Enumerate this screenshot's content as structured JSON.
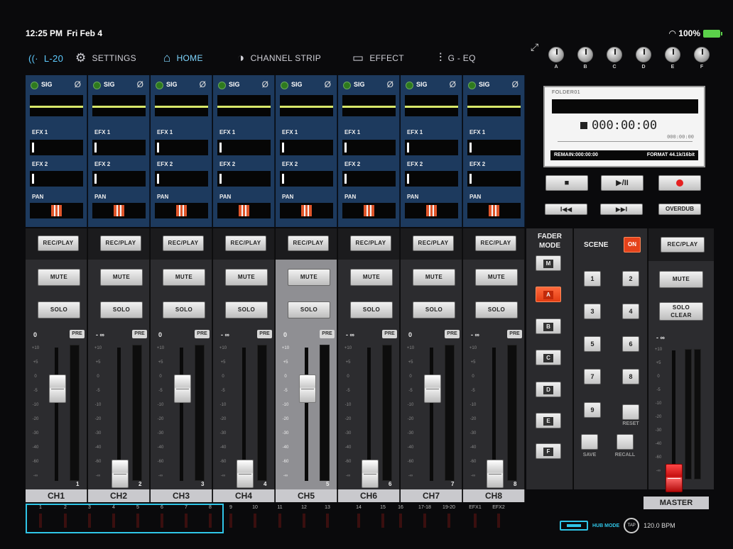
{
  "status": {
    "time": "12:25 PM",
    "date": "Fri Feb 4",
    "battery": "100%"
  },
  "nav": {
    "logo": "L-20",
    "items": [
      {
        "label": "SETTINGS",
        "icon": "gear-icon"
      },
      {
        "label": "HOME",
        "icon": "home-icon",
        "active": true
      },
      {
        "label": "CHANNEL STRIP",
        "icon": "channel-strip-icon"
      },
      {
        "label": "EFFECT",
        "icon": "effect-icon"
      },
      {
        "label": "G - EQ",
        "icon": "eq-sliders-icon"
      }
    ]
  },
  "knobs": [
    "A",
    "B",
    "C",
    "D",
    "E",
    "F"
  ],
  "channel_labels": {
    "sig": "SIG",
    "phase": "Ø",
    "efx1": "EFX 1",
    "efx2": "EFX 2",
    "pan": "PAN",
    "rec_play": "REC/PLAY",
    "mute": "MUTE",
    "solo": "SOLO",
    "pre": "PRE"
  },
  "channels": [
    {
      "name": "CH1",
      "level": "0",
      "fader_db": 0,
      "num": "1"
    },
    {
      "name": "CH2",
      "level": "- ∞",
      "fader_db": -70,
      "num": "2"
    },
    {
      "name": "CH3",
      "level": "0",
      "fader_db": 0,
      "num": "3"
    },
    {
      "name": "CH4",
      "level": "- ∞",
      "fader_db": -70,
      "num": "4"
    },
    {
      "name": "CH5",
      "level": "0",
      "fader_db": 0,
      "num": "5",
      "selected": true
    },
    {
      "name": "CH6",
      "level": "- ∞",
      "fader_db": -70,
      "num": "6"
    },
    {
      "name": "CH7",
      "level": "0",
      "fader_db": 0,
      "num": "7"
    },
    {
      "name": "CH8",
      "level": "- ∞",
      "fader_db": -70,
      "num": "8"
    }
  ],
  "scale_marks": [
    "+10",
    "+5",
    "0",
    "-5",
    "-10",
    "-20",
    "-30",
    "-40",
    "-60",
    "-∞"
  ],
  "inputs": [
    "1",
    "2",
    "3",
    "4",
    "5",
    "6",
    "7",
    "8",
    "9",
    "10",
    "11",
    "12",
    "13",
    "14",
    "15",
    "16",
    "17-18",
    "19-20",
    "EFX1",
    "EFX2"
  ],
  "recorder": {
    "folder": "FOLDER01",
    "timecode": "000:00:00",
    "total": "000:00:00",
    "remain": "REMAIN:000:00:00",
    "format": "FORMAT 44.1k/16bit",
    "buttons": {
      "stop": "■",
      "play_pause": "▶/II",
      "rewind": "I◀◀",
      "forward": "▶▶I",
      "overdub": "OVERDUB"
    }
  },
  "fader_mode": {
    "title_line1": "FADER",
    "title_line2": "MODE",
    "buttons": [
      "M",
      "A",
      "B",
      "C",
      "D",
      "E",
      "F"
    ],
    "active": "A"
  },
  "scene": {
    "title": "SCENE",
    "on": "ON",
    "numbers": [
      "1",
      "2",
      "3",
      "4",
      "5",
      "6",
      "7",
      "8",
      "9"
    ],
    "reset": "RESET",
    "save": "SAVE",
    "recall": "RECALL"
  },
  "master": {
    "name": "MASTER",
    "rec_play": "REC/PLAY",
    "mute": "MUTE",
    "solo_line1": "SOLO",
    "solo_line2": "CLEAR",
    "level": "- ∞"
  },
  "footer": {
    "hub_mode": "HUB MODE",
    "tap": "TAP",
    "bpm": "120.0 BPM"
  },
  "colors": {
    "accent": "#2fc6e8",
    "channel_blue": "#1d3a5e",
    "active_orange": "#e5421b"
  }
}
